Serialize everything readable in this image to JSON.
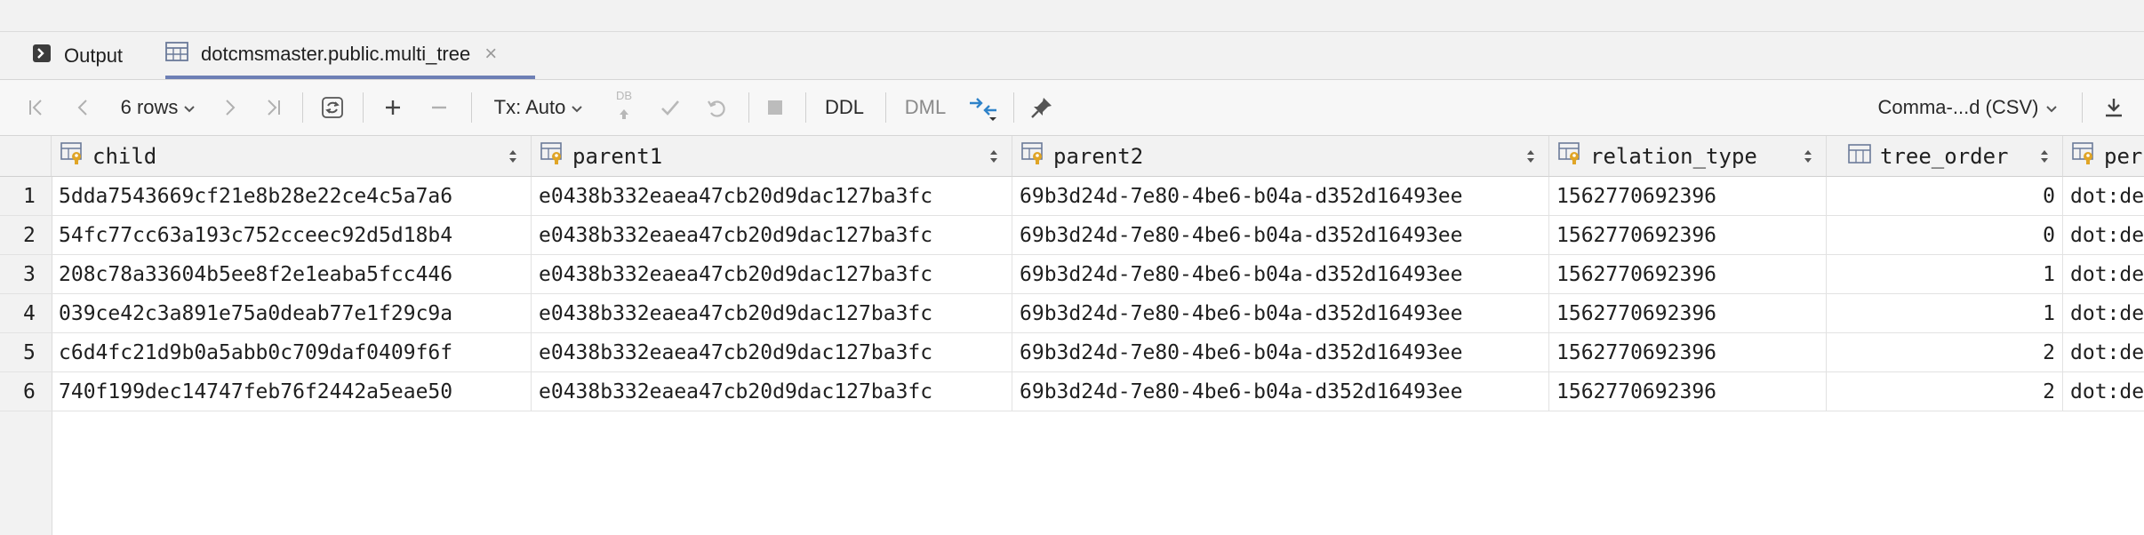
{
  "tabs": [
    {
      "label": "Output",
      "icon": "console-icon"
    },
    {
      "label": "dotcmsmaster.public.multi_tree",
      "icon": "table-icon",
      "active": true
    }
  ],
  "toolbar": {
    "rows_label": "6 rows",
    "tx_label": "Tx: Auto",
    "db_label": "DB",
    "ddl_label": "DDL",
    "dml_label": "DML",
    "format_label": "Comma-...d (CSV)"
  },
  "table": {
    "columns": [
      "child",
      "parent1",
      "parent2",
      "relation_type",
      "tree_order",
      "per"
    ],
    "rows": [
      [
        "5dda7543669cf21e8b28e22ce4c5a7a6",
        "e0438b332eaea47cb20d9dac127ba3fc",
        "69b3d24d-7e80-4be6-b04a-d352d16493ee",
        "1562770692396",
        "0",
        "dot:de"
      ],
      [
        "54fc77cc63a193c752cceec92d5d18b4",
        "e0438b332eaea47cb20d9dac127ba3fc",
        "69b3d24d-7e80-4be6-b04a-d352d16493ee",
        "1562770692396",
        "0",
        "dot:de"
      ],
      [
        "208c78a33604b5ee8f2e1eaba5fcc446",
        "e0438b332eaea47cb20d9dac127ba3fc",
        "69b3d24d-7e80-4be6-b04a-d352d16493ee",
        "1562770692396",
        "1",
        "dot:de"
      ],
      [
        "039ce42c3a891e75a0deab77e1f29c9a",
        "e0438b332eaea47cb20d9dac127ba3fc",
        "69b3d24d-7e80-4be6-b04a-d352d16493ee",
        "1562770692396",
        "1",
        "dot:de"
      ],
      [
        "c6d4fc21d9b0a5abb0c709daf0409f6f",
        "e0438b332eaea47cb20d9dac127ba3fc",
        "69b3d24d-7e80-4be6-b04a-d352d16493ee",
        "1562770692396",
        "2",
        "dot:de"
      ],
      [
        "740f199dec14747feb76f2442a5eae50",
        "e0438b332eaea47cb20d9dac127ba3fc",
        "69b3d24d-7e80-4be6-b04a-d352d16493ee",
        "1562770692396",
        "2",
        "dot:de"
      ]
    ],
    "row_numbers": [
      "1",
      "2",
      "3",
      "4",
      "5",
      "6"
    ]
  }
}
